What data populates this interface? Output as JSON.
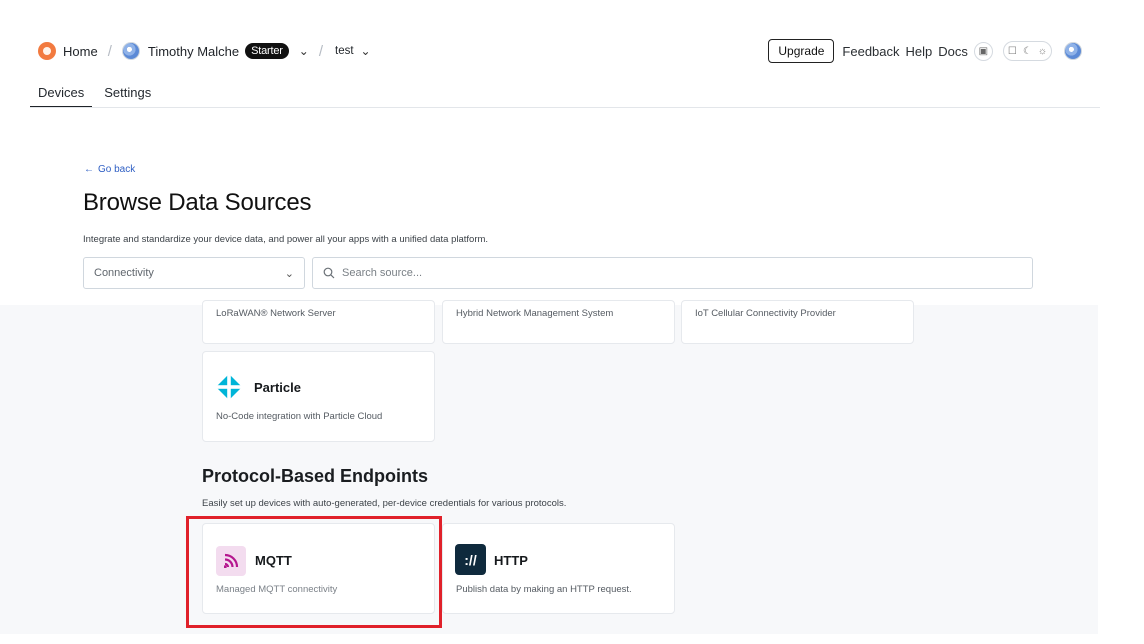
{
  "header": {
    "breadcrumb": {
      "home": "Home",
      "user": "Timothy Malche",
      "plan_badge": "Starter",
      "project": "test"
    },
    "actions": {
      "upgrade": "Upgrade",
      "feedback": "Feedback",
      "help": "Help",
      "docs": "Docs"
    }
  },
  "tabs": [
    {
      "label": "Devices",
      "active": true
    },
    {
      "label": "Settings",
      "active": false
    }
  ],
  "page": {
    "go_back": "Go back",
    "title": "Browse Data Sources",
    "subtitle": "Integrate and standardize your device data, and power all your apps with a unified data platform."
  },
  "filters": {
    "category_value": "Connectivity",
    "search_placeholder": "Search source..."
  },
  "connectivity_cards": [
    {
      "description": "LoRaWAN® Network Server"
    },
    {
      "description": "Hybrid Network Management System"
    },
    {
      "description": "IoT Cellular Connectivity Provider"
    },
    {
      "title": "Particle",
      "description": "No-Code integration with Particle Cloud"
    }
  ],
  "protocol_section": {
    "title": "Protocol-Based Endpoints",
    "subtitle": "Easily set up devices with auto-generated, per-device credentials for various protocols.",
    "cards": [
      {
        "title": "MQTT",
        "description": "Managed MQTT connectivity"
      },
      {
        "title": "HTTP",
        "description": "Publish data by making an HTTP request.",
        "icon_text": "://"
      }
    ]
  },
  "colors": {
    "highlight": "#e0212a",
    "mqtt_icon_bg": "#f3dcef",
    "mqtt_icon_fg": "#b5178f",
    "http_icon_bg": "#0f2a3d",
    "particle": "#00b5d8",
    "link": "#2f5fc4"
  }
}
